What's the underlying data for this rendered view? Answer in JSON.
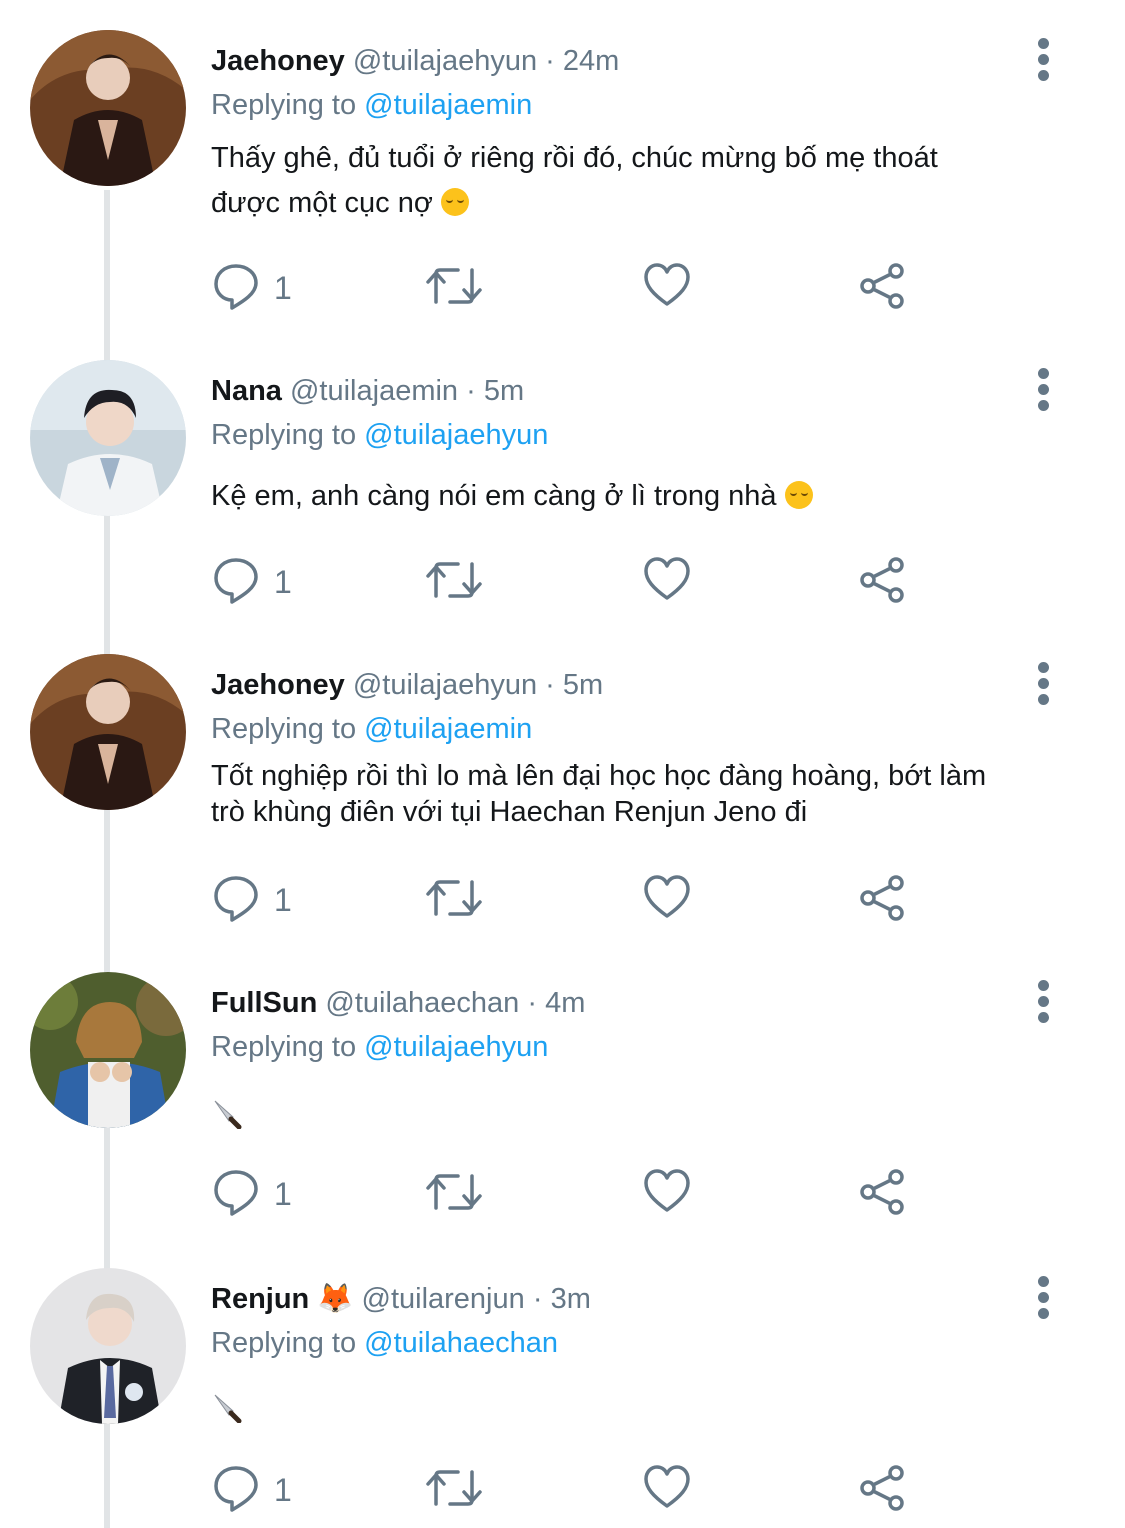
{
  "tweets": [
    {
      "name": "Jaehoney",
      "handle": "@tuilajaehyun",
      "time": "24m",
      "replying_label": "Replying to",
      "replying_handle": "@tuilajaemin",
      "lines": [
        "Thấy ghê, đủ tuổi ở riêng rồi đó, chúc mừng bố mẹ thoát",
        "được một cục nợ"
      ],
      "emoji": "relieved-face",
      "reply_count": "1"
    },
    {
      "name": "Nana",
      "handle": "@tuilajaemin",
      "time": "5m",
      "replying_label": "Replying to",
      "replying_handle": "@tuilajaehyun",
      "lines": [
        "Kệ em, anh càng nói em càng ở lì trong nhà"
      ],
      "emoji": "relieved-face",
      "reply_count": "1"
    },
    {
      "name": "Jaehoney",
      "handle": "@tuilajaehyun",
      "time": "5m",
      "replying_label": "Replying to",
      "replying_handle": "@tuilajaemin",
      "lines": [
        "Tốt nghiệp rồi thì lo mà lên đại học học đàng hoàng, bớt làm",
        "trò khùng điên với tụi Haechan Renjun Jeno đi"
      ],
      "reply_count": "1"
    },
    {
      "name": "FullSun",
      "handle": "@tuilahaechan",
      "time": "4m",
      "replying_label": "Replying to",
      "replying_handle": "@tuilajaehyun",
      "emoji": "knife",
      "reply_count": "1"
    },
    {
      "name": "Renjun 🦊",
      "handle": "@tuilarenjun",
      "time": "3m",
      "replying_label": "Replying to",
      "replying_handle": "@tuilahaechan",
      "emoji": "knife",
      "reply_count": "1"
    }
  ],
  "separator": "·",
  "icons": [
    "reply-icon",
    "retweet-icon",
    "like-icon",
    "share-icon",
    "more-options-icon"
  ],
  "colors": {
    "link": "#1da1f2",
    "muted": "#657786",
    "text": "#14171a",
    "thread_line": "#e1e4e6"
  }
}
